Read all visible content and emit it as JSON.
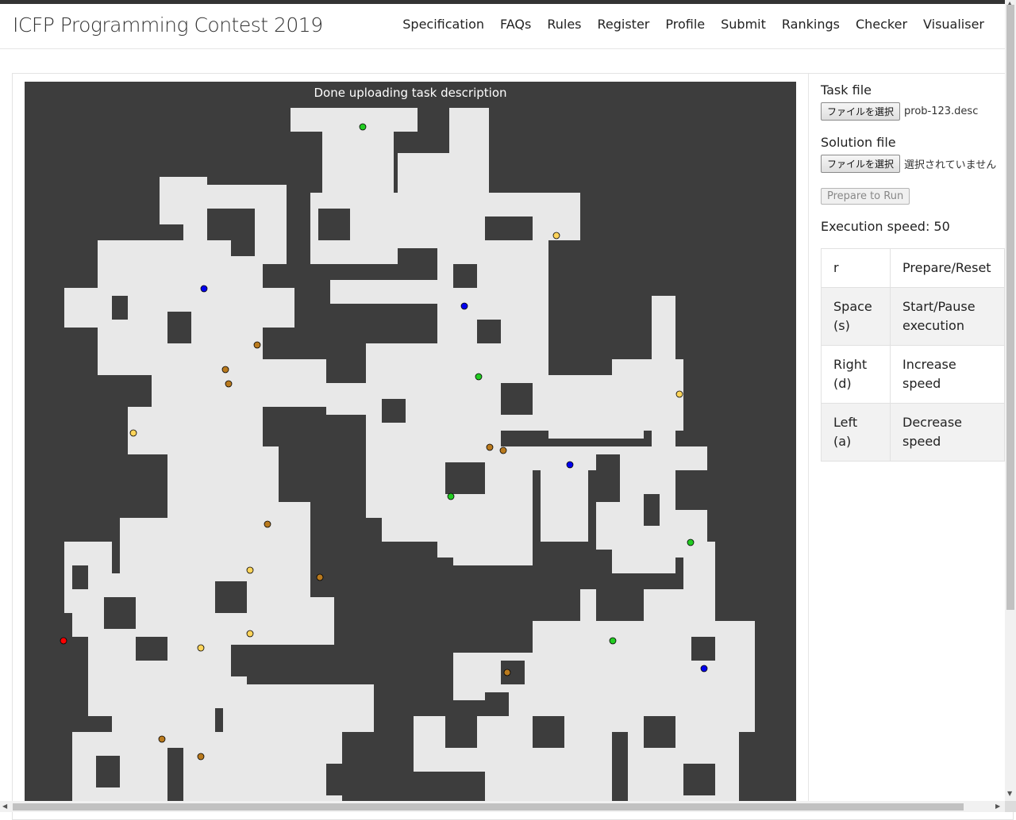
{
  "brand": "ICFP Programming Contest 2019",
  "nav": [
    "Specification",
    "FAQs",
    "Rules",
    "Register",
    "Profile",
    "Submit",
    "Rankings",
    "Checker",
    "Visualiser"
  ],
  "visualiser": {
    "status": "Done uploading task description",
    "colors": {
      "background": "#3d3d3d",
      "floor": "#e8e8e8",
      "robot": "#ff0000",
      "booster_B": "#ffd45a",
      "booster_F": "#b97a1e",
      "booster_L": "#22cc22",
      "booster_X": "#0000ee"
    }
  },
  "task_file": {
    "label": "Task file",
    "button": "ファイルを選択",
    "filename": "prob-123.desc"
  },
  "solution_file": {
    "label": "Solution file",
    "button": "ファイルを選択",
    "filename": "選択されていません"
  },
  "prepare_button": "Prepare to Run",
  "speed_text": "Execution speed: 50",
  "controls": [
    {
      "key": "r",
      "action": "Prepare/Reset"
    },
    {
      "key": "Space (s)",
      "action": "Start/Pause execution"
    },
    {
      "key": "Right (d)",
      "action": "Increase speed"
    },
    {
      "key": "Left (a)",
      "action": "Decrease speed"
    }
  ]
}
